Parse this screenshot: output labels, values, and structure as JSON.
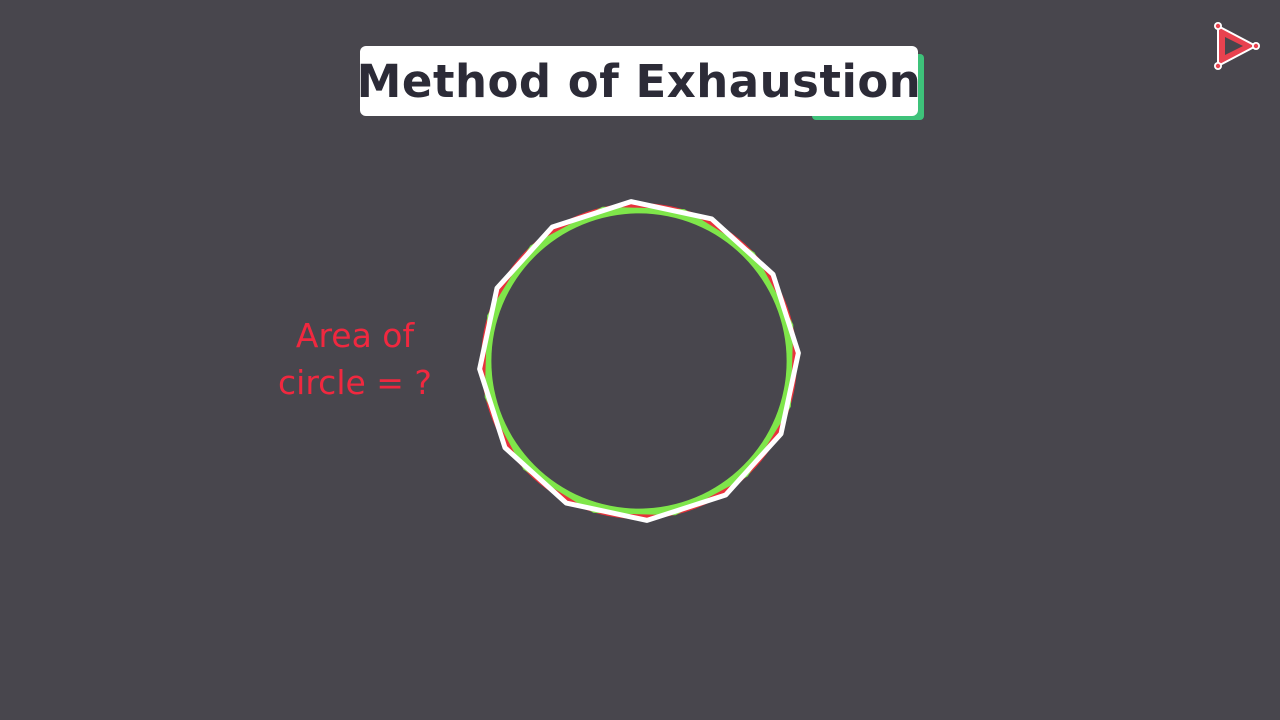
{
  "title": "Method of Exhaustion",
  "question": {
    "line1": "Area of",
    "line2": "circle = ?"
  },
  "diagram": {
    "polygon_sides": 12,
    "colors": {
      "background": "#48464d",
      "circle_fill": "#e8323c",
      "inscribed_polygon": "#7fe64a",
      "circumscribed_polygon": "#ffffff",
      "title_accent": "#3ec27a",
      "question_text": "#f0283f"
    }
  },
  "logo": {
    "icon": "play-logo-icon"
  }
}
